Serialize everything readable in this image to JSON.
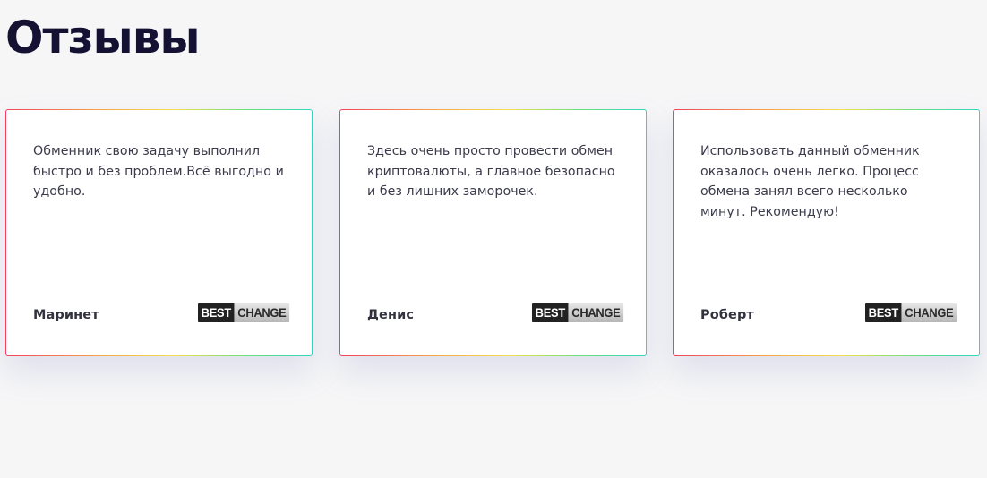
{
  "page": {
    "title": "Отзывы"
  },
  "reviews": [
    {
      "text": "Обменник свою задачу выполнил быстро и без проблем.Всё выгодно и удобно.",
      "author": "Маринет",
      "source_logo": {
        "part1": "BEST",
        "part2": "CHANGE"
      }
    },
    {
      "text": "Здесь очень просто провести обмен криптовалюты, а главное безопасно и без лишних заморочек.",
      "author": "Денис",
      "source_logo": {
        "part1": "BEST",
        "part2": "CHANGE"
      }
    },
    {
      "text": "Использовать данный обменник оказалось очень легко. Процесс обмена занял всего несколько минут. Рекомендую!",
      "author": "Роберт",
      "source_logo": {
        "part1": "BEST",
        "part2": "CHANGE"
      }
    }
  ],
  "colors": {
    "background": "#f6f6f7",
    "title": "#151133",
    "card_border_gradient": [
      "#f2405e",
      "#f7a24a",
      "#f4e04a",
      "#6be07b",
      "#2fd6c2"
    ],
    "logo_dark": "#222222",
    "logo_light": "#d0d0d0"
  }
}
